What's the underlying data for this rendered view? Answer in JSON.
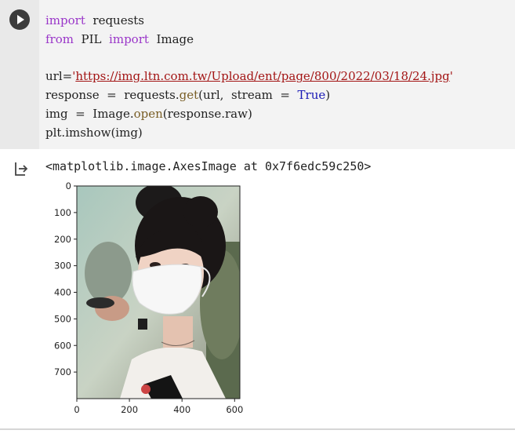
{
  "cell": {
    "run_button_label": "",
    "code": {
      "line1": {
        "kw": "import",
        "rest": "  requests"
      },
      "line2": {
        "kw1": "from",
        "mid": "  PIL  ",
        "kw2": "import",
        "rest": "  Image"
      },
      "line4": {
        "pre": "url=",
        "q1": "'",
        "url": "https://img.ltn.com.tw/Upload/ent/page/800/2022/03/18/24.jpg",
        "q2": "'"
      },
      "line5": {
        "pre": "response  =  requests.",
        "fn": "get",
        "mid": "(url,  stream  =  ",
        "bool": "True",
        "post": ")"
      },
      "line6": {
        "pre": "img  =  Image.",
        "fn": "open",
        "post": "(response.raw)"
      },
      "line7": {
        "text": "plt.imshow(img)"
      }
    }
  },
  "output": {
    "icon": "output-arrow-icon",
    "text": "<matplotlib.image.AxesImage at 0x7f6edc59c250>",
    "plot": {
      "y_ticks": [
        "0",
        "100",
        "200",
        "300",
        "400",
        "500",
        "600",
        "700"
      ],
      "x_ticks": [
        "0",
        "200",
        "400",
        "600"
      ],
      "image_description_alt": "photo"
    }
  },
  "colors": {
    "keyword": "#9a36c9",
    "string": "#a31515",
    "boolean": "#1a1ab5",
    "function": "#795e26",
    "editor_bg": "#f3f3f3",
    "gutter_bg": "#e9e9e9"
  }
}
